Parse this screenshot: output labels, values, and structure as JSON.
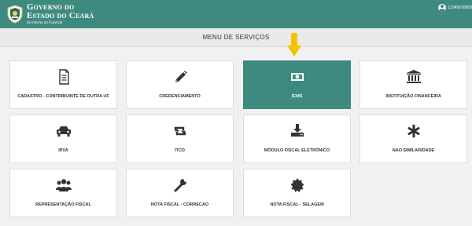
{
  "header": {
    "logo_line1": "Governo do",
    "logo_line2": "Estado do Ceará",
    "logo_line3": "Secretaria da Fazenda",
    "user_id": "12345678900"
  },
  "title": "MENU DE SERVIÇOS",
  "services": [
    {
      "label": "CADASTRO - CONTRIBUINTE DE OUTRA UF",
      "icon": "document-icon"
    },
    {
      "label": "CREDENCIAMENTO",
      "icon": "pencil-icon"
    },
    {
      "label": "ICMS",
      "icon": "money-icon",
      "active": true
    },
    {
      "label": "INSTITUIÇÃO FINANCEIRA",
      "icon": "bank-icon"
    },
    {
      "label": "IPVA",
      "icon": "car-icon"
    },
    {
      "label": "ITCD",
      "icon": "retweet-icon"
    },
    {
      "label": "MÓDULO FISCAL ELETRÔNICO",
      "icon": "download-icon"
    },
    {
      "label": "NAO SIMILARIDADE",
      "icon": "asterisk-icon"
    },
    {
      "label": "REPRESENTAÇÃO FISCAL",
      "icon": "users-icon"
    },
    {
      "label": "NOTA FISCAL - CORRECAO",
      "icon": "wrench-icon"
    },
    {
      "label": "NOTA FISCAL - SELAGEM",
      "icon": "seal-icon"
    }
  ],
  "colors": {
    "header_bg": "#3f8a7f",
    "active_card_bg": "#3f8a7f",
    "arrow": "#f5c200"
  }
}
